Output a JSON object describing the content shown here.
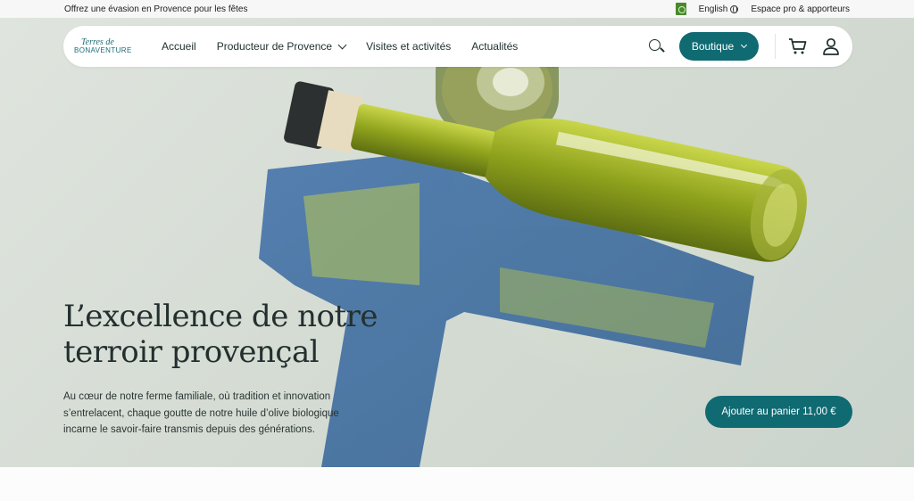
{
  "topbar": {
    "promo": "Offrez une évasion en Provence pour les fêtes",
    "language": "English",
    "pro_link": "Espace pro & apporteurs"
  },
  "nav": {
    "logo_top": "Terres de",
    "logo_bottom": "BONAVENTURE",
    "items": [
      {
        "label": "Accueil"
      },
      {
        "label": "Producteur de Provence"
      },
      {
        "label": "Visites et activités"
      },
      {
        "label": "Actualités"
      }
    ],
    "shop_label": "Boutique"
  },
  "hero": {
    "title": "L’excellence de notre terroir provençal",
    "description": "Au cœur de notre ferme familiale, où tradition et innovation s’entrelacent, chaque goutte de notre huile d’olive biologique incarne le savoir-faire transmis depuis des générations.",
    "cta": "Ajouter au panier 11,00 €"
  },
  "colors": {
    "accent": "#0f6a72",
    "hero_bg": "#d5dcd4"
  },
  "icons": [
    "organic-label-icon",
    "globe-icon",
    "search-icon",
    "chevron-down-icon",
    "cart-icon",
    "user-icon"
  ]
}
